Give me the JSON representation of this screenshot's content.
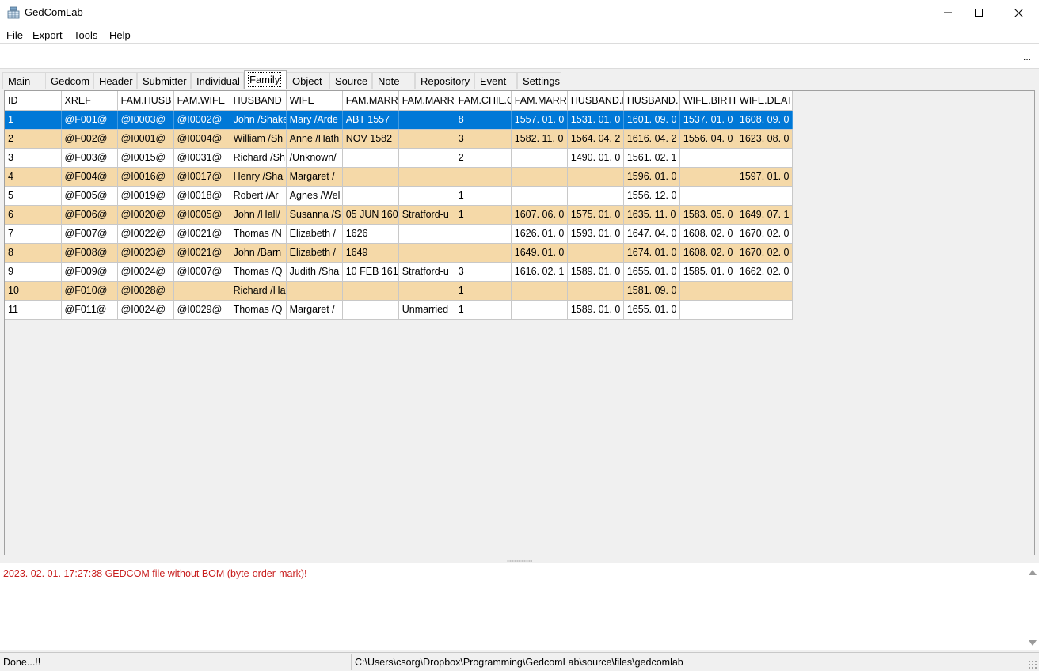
{
  "window": {
    "title": "GedComLab",
    "app_icon": "database-table-icon",
    "controls": [
      "minimize-icon",
      "maximize-icon",
      "close-icon"
    ]
  },
  "menu": {
    "items": [
      "File",
      "Export",
      "Tools",
      "Help"
    ]
  },
  "pathbar": {
    "value": "",
    "ellipsis_label": "..."
  },
  "tabs": {
    "items": [
      "Main",
      "Gedcom",
      "Header",
      "Submitter",
      "Individual",
      "Family",
      "Object",
      "Source",
      "Note",
      "Repository",
      "Event",
      "Settings"
    ],
    "active": "Family"
  },
  "grid": {
    "columns": [
      "ID",
      "XREF",
      "FAM.HUSB",
      "FAM.WIFE",
      "HUSBAND",
      "WIFE",
      "FAM.MARR",
      "FAM.MARR",
      "FAM.CHIL.C",
      "FAM.MARR",
      "HUSBAND.B",
      "HUSBAND.D",
      "WIFE.BIRTH",
      "WIFE.DEATH"
    ],
    "selected_row": 0,
    "alt_row_color": "#f5d9a8",
    "selection_color": "#0078d7",
    "rows": [
      [
        "1",
        "@F001@",
        "@I0003@",
        "@I0002@",
        "John /Shake",
        "Mary /Arde",
        "ABT 1557",
        "",
        "8",
        "1557. 01. 0",
        "1531. 01. 0",
        "1601. 09. 0",
        "1537. 01. 0",
        "1608. 09. 0"
      ],
      [
        "2",
        "@F002@",
        "@I0001@",
        "@I0004@",
        "William /Sh",
        "Anne /Hath",
        "NOV 1582",
        "",
        "3",
        "1582. 11. 0",
        "1564. 04. 2",
        "1616. 04. 2",
        "1556. 04. 0",
        "1623. 08. 0"
      ],
      [
        "3",
        "@F003@",
        "@I0015@",
        "@I0031@",
        "Richard /Sh",
        " /Unknown/",
        "",
        "",
        "2",
        "",
        "1490. 01. 0",
        "1561. 02. 1",
        "",
        ""
      ],
      [
        "4",
        "@F004@",
        "@I0016@",
        "@I0017@",
        "Henry /Sha",
        "Margaret /",
        "",
        "",
        "",
        "",
        "",
        "1596. 01. 0",
        "",
        "1597. 01. 0"
      ],
      [
        "5",
        "@F005@",
        "@I0019@",
        "@I0018@",
        "Robert /Ar",
        "Agnes /Wel",
        "",
        "",
        "1",
        "",
        "",
        "1556. 12. 0",
        "",
        ""
      ],
      [
        "6",
        "@F006@",
        "@I0020@",
        "@I0005@",
        "John /Hall/",
        "Susanna /S",
        "05 JUN 160",
        "Stratford-u",
        "1",
        "1607. 06. 0",
        "1575. 01. 0",
        "1635. 11. 0",
        "1583. 05. 0",
        "1649. 07. 1"
      ],
      [
        "7",
        "@F007@",
        "@I0022@",
        "@I0021@",
        "Thomas /N",
        "Elizabeth /",
        "1626",
        "",
        "",
        "1626. 01. 0",
        "1593. 01. 0",
        "1647. 04. 0",
        "1608. 02. 0",
        "1670. 02. 0"
      ],
      [
        "8",
        "@F008@",
        "@I0023@",
        "@I0021@",
        "John /Barn",
        "Elizabeth /",
        "1649",
        "",
        "",
        "1649. 01. 0",
        "",
        "1674. 01. 0",
        "1608. 02. 0",
        "1670. 02. 0"
      ],
      [
        "9",
        "@F009@",
        "@I0024@",
        "@I0007@",
        "Thomas /Q",
        "Judith /Sha",
        "10 FEB 161",
        "Stratford-u",
        "3",
        "1616. 02. 1",
        "1589. 01. 0",
        "1655. 01. 0",
        "1585. 01. 0",
        "1662. 02. 0"
      ],
      [
        "10",
        "@F010@",
        "@I0028@",
        "",
        "Richard /Ha",
        "",
        "",
        "",
        "1",
        "",
        "",
        "1581. 09. 0",
        "",
        ""
      ],
      [
        "11",
        "@F011@",
        "@I0024@",
        "@I0029@",
        "Thomas /Q",
        "Margaret /",
        "",
        "Unmarried",
        "1",
        "",
        "1589. 01. 0",
        "1655. 01. 0",
        "",
        ""
      ]
    ]
  },
  "log": {
    "text": "2023. 02. 01. 17:27:38 GEDCOM file without BOM (byte-order-mark)!",
    "color": "#c81e1e"
  },
  "status": {
    "left": "Done...!!",
    "right": "C:\\Users\\csorg\\Dropbox\\Programming\\GedcomLab\\source\\files\\gedcomlab"
  }
}
